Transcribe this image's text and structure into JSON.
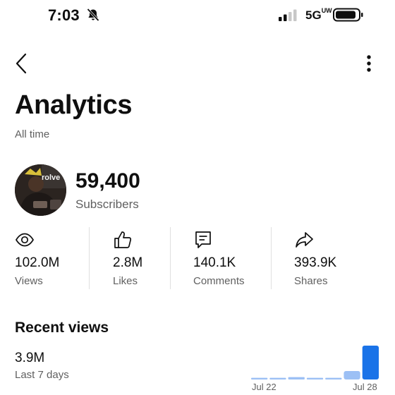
{
  "status_bar": {
    "time": "7:03",
    "network": "5G",
    "network_sup": "UW"
  },
  "page": {
    "title": "Analytics",
    "subtitle": "All time"
  },
  "channel": {
    "subscribers": "59,400",
    "subscribers_label": "Subscribers",
    "avatar_text": "rolve"
  },
  "stats": [
    {
      "icon": "eye-icon",
      "value": "102.0M",
      "label": "Views"
    },
    {
      "icon": "thumbs-up-icon",
      "value": "2.8M",
      "label": "Likes"
    },
    {
      "icon": "comment-icon",
      "value": "140.1K",
      "label": "Comments"
    },
    {
      "icon": "share-icon",
      "value": "393.9K",
      "label": "Shares"
    }
  ],
  "recent": {
    "title": "Recent views",
    "value": "3.9M",
    "label": "Last 7 days"
  },
  "chart_data": {
    "type": "bar",
    "categories": [
      "Jul 22",
      "",
      "",
      "",
      "",
      "",
      "Jul 28"
    ],
    "x_tick_labels": [
      "Jul 22",
      "Jul 28"
    ],
    "values": [
      0.05,
      0.05,
      0.07,
      0.05,
      0.05,
      0.25,
      1.0
    ],
    "colors": {
      "light": "#9cc0f5",
      "dark": "#1a73e8"
    }
  }
}
